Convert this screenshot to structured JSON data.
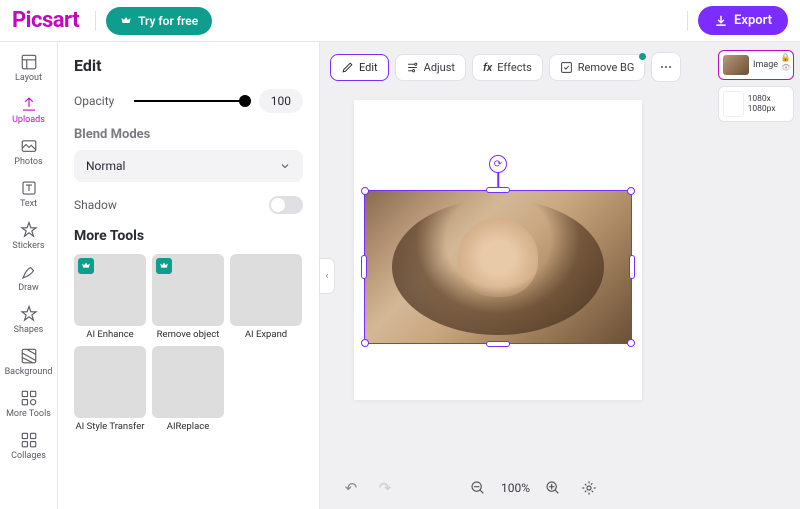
{
  "brand": "Picsart",
  "header": {
    "try_label": "Try for free",
    "export_label": "Export"
  },
  "leftnav": {
    "items": [
      {
        "label": "Layout",
        "icon": "layout-icon"
      },
      {
        "label": "Uploads",
        "icon": "uploads-icon",
        "active": true
      },
      {
        "label": "Photos",
        "icon": "photos-icon"
      },
      {
        "label": "Text",
        "icon": "text-icon"
      },
      {
        "label": "Stickers",
        "icon": "stickers-icon"
      },
      {
        "label": "Draw",
        "icon": "draw-icon"
      },
      {
        "label": "Shapes",
        "icon": "shapes-icon"
      },
      {
        "label": "Background",
        "icon": "background-icon"
      },
      {
        "label": "More Tools",
        "icon": "more-tools-icon"
      },
      {
        "label": "Collages",
        "icon": "collages-icon"
      }
    ]
  },
  "panel": {
    "title": "Edit",
    "opacity_label": "Opacity",
    "opacity_value": "100",
    "blend_modes_label": "Blend Modes",
    "blend_mode_value": "Normal",
    "shadow_label": "Shadow",
    "more_tools_label": "More Tools",
    "tools": [
      {
        "label": "AI Enhance",
        "premium": true
      },
      {
        "label": "Remove object",
        "premium": true
      },
      {
        "label": "AI Expand",
        "premium": false
      },
      {
        "label": "AI Style Transfer",
        "premium": false
      },
      {
        "label": "AIReplace",
        "premium": false
      }
    ]
  },
  "toolstrip": {
    "edit": "Edit",
    "adjust": "Adjust",
    "effects": "Effects",
    "remove_bg": "Remove BG"
  },
  "zoom": {
    "value": "100%"
  },
  "layers": {
    "image_label": "Image",
    "canvas_size": "1080x 1080px"
  }
}
